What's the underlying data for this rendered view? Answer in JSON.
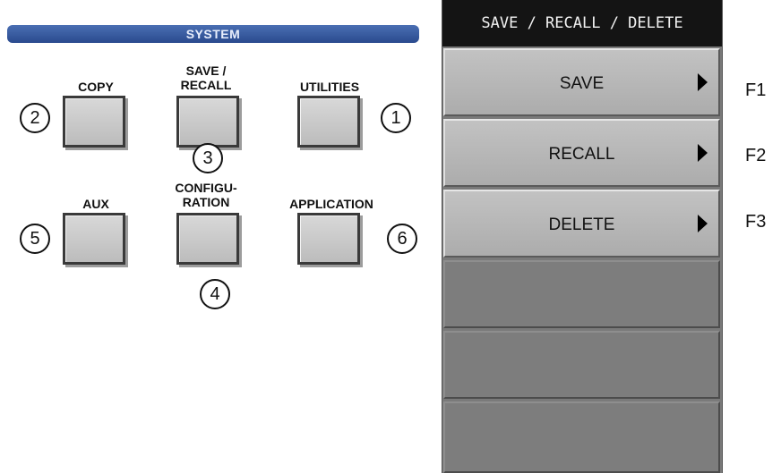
{
  "system_panel": {
    "title": "SYSTEM",
    "keys": [
      {
        "label": "COPY",
        "callout": "2"
      },
      {
        "label_line1": "SAVE /",
        "label_line2": "RECALL",
        "callout": "3"
      },
      {
        "label": "UTILITIES",
        "callout": "1"
      },
      {
        "label": "AUX",
        "callout": "5"
      },
      {
        "label_line1": "CONFIGU-",
        "label_line2": "RATION",
        "callout": "4"
      },
      {
        "label": "APPLICATION",
        "callout": "6"
      }
    ]
  },
  "menu": {
    "title": "SAVE / RECALL / DELETE",
    "items": [
      {
        "label": "SAVE",
        "fkey": "F1",
        "has_submenu": true
      },
      {
        "label": "RECALL",
        "fkey": "F2",
        "has_submenu": true
      },
      {
        "label": "DELETE",
        "fkey": "F3",
        "has_submenu": true
      }
    ]
  },
  "colors": {
    "system_bar": "#2a4a8e",
    "menu_title_bg": "#141414",
    "menu_bg": "#7a7a7a"
  }
}
